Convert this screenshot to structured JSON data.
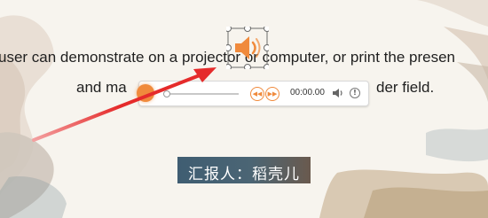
{
  "slide": {
    "line1": "user can demonstrate on a projector or computer, or print the presen",
    "line2_start": "and ma",
    "line2_end": "der field.",
    "presenter_label": "汇报人：稻壳儿"
  },
  "media_player": {
    "time": "00:00.00",
    "play_icon": "play-icon",
    "rewind_icon": "rewind-icon",
    "forward_icon": "fast-forward-icon",
    "volume_icon": "volume-icon",
    "info_icon": "info-icon",
    "accent_color": "#f08a3c"
  },
  "audio_object": {
    "icon": "speaker-icon",
    "selection_handles": 8
  },
  "annotation": {
    "arrow_color": "#e52b2b",
    "icon": "red-arrow"
  }
}
